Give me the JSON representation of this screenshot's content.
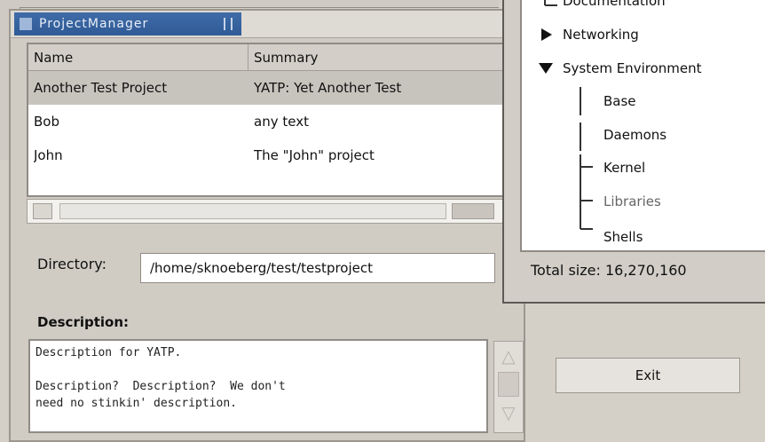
{
  "project_window": {
    "title": "ProjectManager",
    "columns": [
      "Name",
      "Summary"
    ],
    "rows": [
      {
        "name": "Another Test Project",
        "summary": "YATP: Yet Another Test"
      },
      {
        "name": "Bob",
        "summary": "any text"
      },
      {
        "name": "John",
        "summary": "The \"John\" project"
      }
    ],
    "directory_label": "Directory:",
    "directory_value": "/home/sknoeberg/test/testproject",
    "description_label": "Description:",
    "description_text": "Description for YATP.\n\nDescription?  Description?  We don't\nneed no stinkin' description."
  },
  "tree_window": {
    "items": [
      {
        "label": "Documentation"
      },
      {
        "label": "Networking"
      },
      {
        "label": "System Environment"
      },
      {
        "label": "Base"
      },
      {
        "label": "Daemons"
      },
      {
        "label": "Kernel"
      },
      {
        "label": "Libraries"
      },
      {
        "label": "Shells"
      }
    ],
    "total_size": "Total size: 16,270,160"
  },
  "exit_label": "Exit",
  "colors": {
    "title_bar": "#3f6ca8",
    "selected_row": "#c7c4bd",
    "window_bg": "#d0ccc4"
  }
}
